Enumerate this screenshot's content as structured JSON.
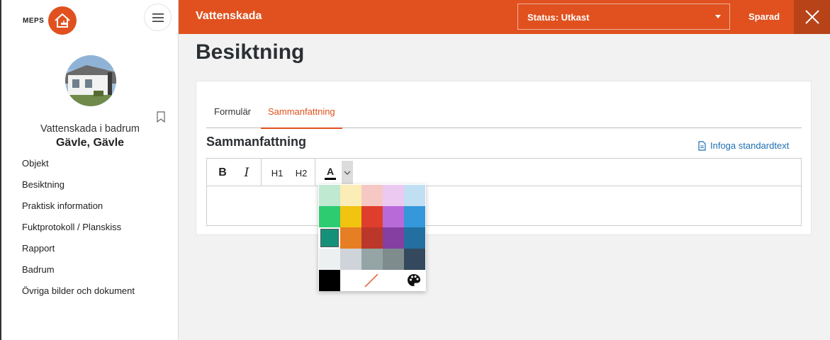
{
  "sidebar": {
    "logo_text": "MEPS",
    "subtitle": "Vattenskada i badrum",
    "title": "Gävle, Gävle",
    "nav": [
      "Objekt",
      "Besiktning",
      "Praktisk information",
      "Fuktprotokoll / Planskiss",
      "Rapport",
      "Badrum",
      "Övriga bilder och dokument"
    ]
  },
  "header": {
    "title": "Vattenskada",
    "status_label": "Status: Utkast",
    "saved_label": "Sparad"
  },
  "main": {
    "page_title": "Besiktning",
    "tabs": [
      "Formulär",
      "Sammanfattning"
    ],
    "active_tab": "Sammanfattning",
    "section_title": "Sammanfattning",
    "insert_link": "Infoga standardtext"
  },
  "toolbar": {
    "bold": "B",
    "italic": "I",
    "h1": "H1",
    "h2": "H2",
    "text_color": "A"
  },
  "palette": {
    "colors": [
      [
        "#bfe9d0",
        "#fbedb5",
        "#f6c8c3",
        "#ecc9f1",
        "#c0dff3"
      ],
      [
        "#2ecc71",
        "#f1c40f",
        "#e03e2d",
        "#b96ad9",
        "#3598db"
      ],
      [
        "#169179",
        "#e67e23",
        "#ba372a",
        "#843fa1",
        "#236fa1"
      ],
      [
        "#ecf0f1",
        "#ced4d9",
        "#95a5a6",
        "#7e8c8d",
        "#34495e"
      ]
    ],
    "selected": "#169179",
    "last_row": [
      "#000000"
    ]
  },
  "colors": {
    "accent": "#e0511f",
    "link": "#1f6fb2"
  }
}
